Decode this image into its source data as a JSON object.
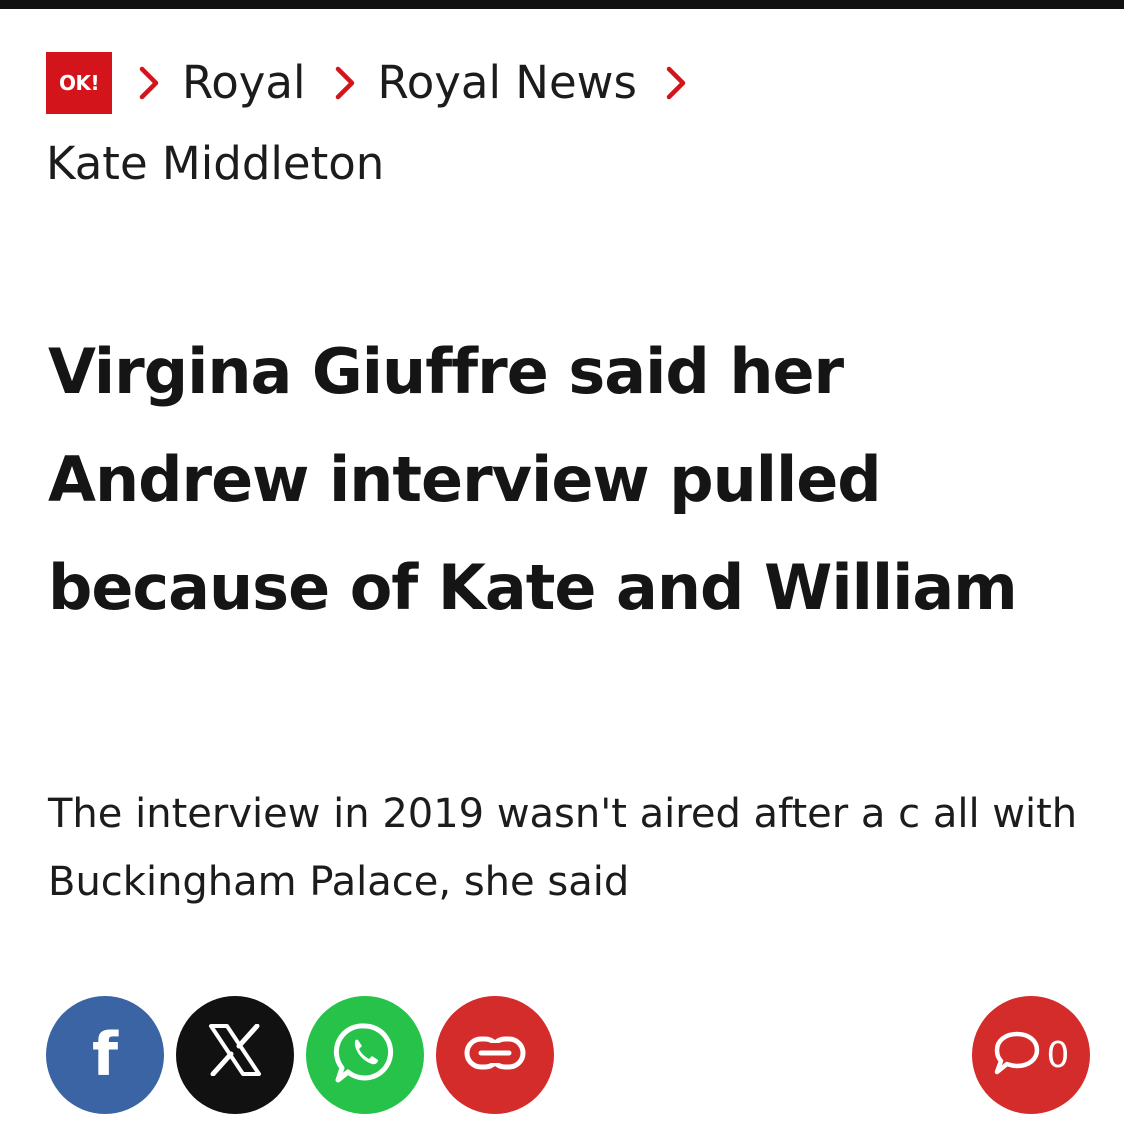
{
  "brand": {
    "logo_text": "OK!",
    "accent_color": "#d3151b"
  },
  "breadcrumb": {
    "items": [
      {
        "label": "Royal"
      },
      {
        "label": "Royal News"
      },
      {
        "label": "Kate Middleton"
      }
    ],
    "separator_icon": "chevron-right-icon"
  },
  "article": {
    "headline": "Virgina Giuffre said her Andrew interview pulled because of Kate and William",
    "standfirst": "The interview in 2019 wasn't aired after a c all with Buckingham Palace, she said"
  },
  "share": {
    "buttons": [
      {
        "icon": "facebook-icon",
        "glyph": "f",
        "color": "#3b64a4"
      },
      {
        "icon": "x-icon",
        "glyph": "𝕏",
        "color": "#111111"
      },
      {
        "icon": "whatsapp-icon",
        "color": "#26c24a"
      },
      {
        "icon": "link-icon",
        "color": "#d42b2b"
      }
    ]
  },
  "comments": {
    "icon": "comment-bubble-icon",
    "count": "0",
    "color": "#d42b2b"
  }
}
